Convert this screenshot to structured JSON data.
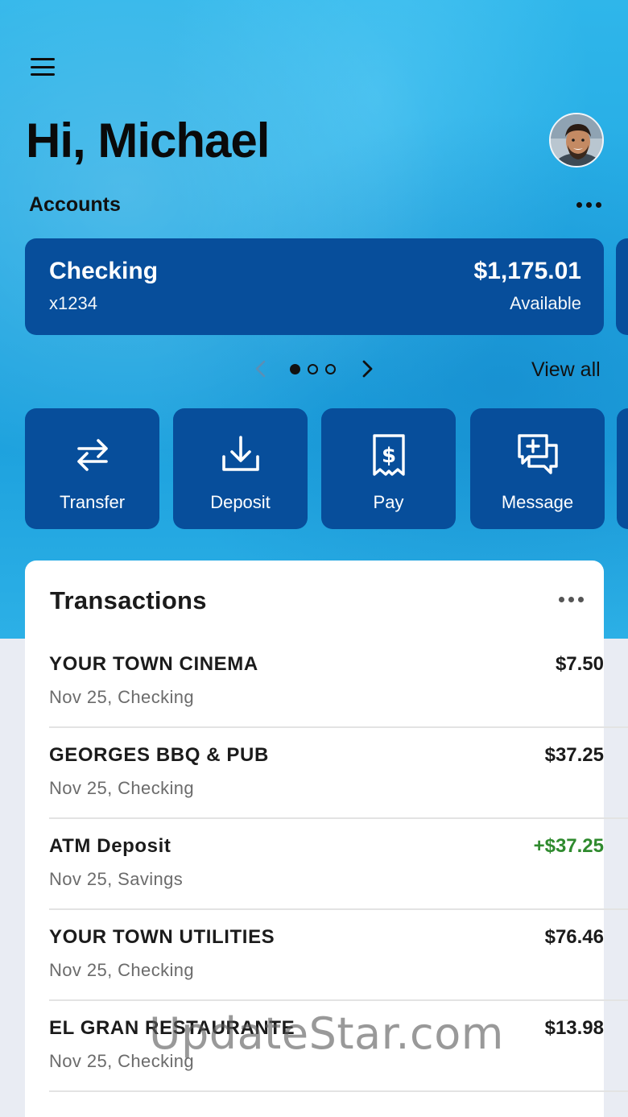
{
  "greeting": "Hi, Michael",
  "accounts": {
    "label": "Accounts",
    "current": {
      "name": "Checking",
      "number": "x1234",
      "balance": "$1,175.01",
      "balance_label": "Available"
    },
    "pager": {
      "total": 3,
      "active_index": 0
    },
    "view_all_label": "View all"
  },
  "actions": [
    {
      "label": "Transfer",
      "icon": "transfer-icon"
    },
    {
      "label": "Deposit",
      "icon": "deposit-icon"
    },
    {
      "label": "Pay",
      "icon": "pay-bill-icon"
    },
    {
      "label": "Message",
      "icon": "message-icon"
    }
  ],
  "transactions": {
    "title": "Transactions",
    "items": [
      {
        "merchant": "YOUR TOWN CINEMA",
        "meta": "Nov 25, Checking",
        "amount": "$7.50",
        "type": "debit"
      },
      {
        "merchant": "GEORGES BBQ & PUB",
        "meta": "Nov 25, Checking",
        "amount": "$37.25",
        "type": "debit"
      },
      {
        "merchant": "ATM Deposit",
        "meta": "Nov 25, Savings",
        "amount": "+$37.25",
        "type": "credit"
      },
      {
        "merchant": "YOUR TOWN UTILITIES",
        "meta": "Nov 25, Checking",
        "amount": "$76.46",
        "type": "debit"
      },
      {
        "merchant": "EL GRAN RESTAURANTE",
        "meta": "Nov 25, Checking",
        "amount": "$13.98",
        "type": "debit"
      }
    ]
  },
  "watermark": "UpdateStar.com",
  "colors": {
    "brand_blue": "#074e9b",
    "sky_background": "#23a9e3",
    "credit_green": "#2f8a2e"
  }
}
